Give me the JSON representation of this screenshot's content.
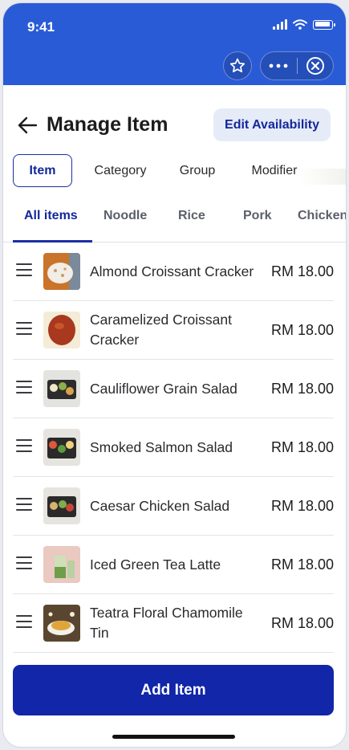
{
  "status_bar": {
    "time": "9:41"
  },
  "mini_app_bar": {
    "icons": [
      "star-icon",
      "more-icon",
      "close-circle-icon"
    ]
  },
  "header": {
    "title": "Manage Item",
    "edit_button_label": "Edit Availability",
    "back_icon": "arrow-left-icon"
  },
  "segment_tabs": [
    {
      "label": "Item",
      "active": true
    },
    {
      "label": "Category",
      "active": false
    },
    {
      "label": "Group",
      "active": false
    },
    {
      "label": "Modifier",
      "active": false
    }
  ],
  "category_tabs": [
    {
      "label": "All items",
      "active": true
    },
    {
      "label": "Noodle",
      "active": false
    },
    {
      "label": "Rice",
      "active": false
    },
    {
      "label": "Pork",
      "active": false
    },
    {
      "label": "Chicken",
      "active": false
    }
  ],
  "items": [
    {
      "name": "Almond Croissant Cracker",
      "price": "RM 18.00"
    },
    {
      "name": "Caramelized Croissant Cracker",
      "price": "RM 18.00"
    },
    {
      "name": "Cauliflower Grain Salad",
      "price": "RM 18.00"
    },
    {
      "name": "Smoked Salmon Salad",
      "price": "RM 18.00"
    },
    {
      "name": "Caesar Chicken Salad",
      "price": "RM 18.00"
    },
    {
      "name": "Iced Green Tea Latte",
      "price": "RM 18.00"
    },
    {
      "name": "Teatra Floral Chamomile Tin",
      "price": "RM 18.00"
    }
  ],
  "add_button_label": "Add Item",
  "colors": {
    "top_bar": "#2a5bd7",
    "primary": "#1126a8",
    "accent_text": "#13289a",
    "chip_bg": "#e6ebf8"
  }
}
